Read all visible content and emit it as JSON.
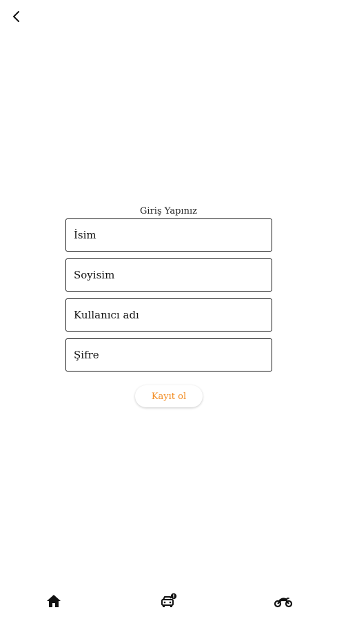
{
  "header": {
    "back_icon": "chevron-left-icon"
  },
  "form": {
    "title": "Giriş Yapınız",
    "fields": [
      {
        "placeholder": "İsim"
      },
      {
        "placeholder": "Soyisim"
      },
      {
        "placeholder": "Kullanıcı adı"
      },
      {
        "placeholder": "Şifre"
      }
    ],
    "submit_label": "Kayıt ol"
  },
  "bottom_nav": {
    "items": [
      {
        "icon": "home-icon"
      },
      {
        "icon": "taxi-alert-icon"
      },
      {
        "icon": "motorcycle-icon"
      }
    ]
  },
  "colors": {
    "accent": "#f28a1e",
    "text": "#111111",
    "border": "#1a1a1a",
    "background": "#ffffff"
  }
}
